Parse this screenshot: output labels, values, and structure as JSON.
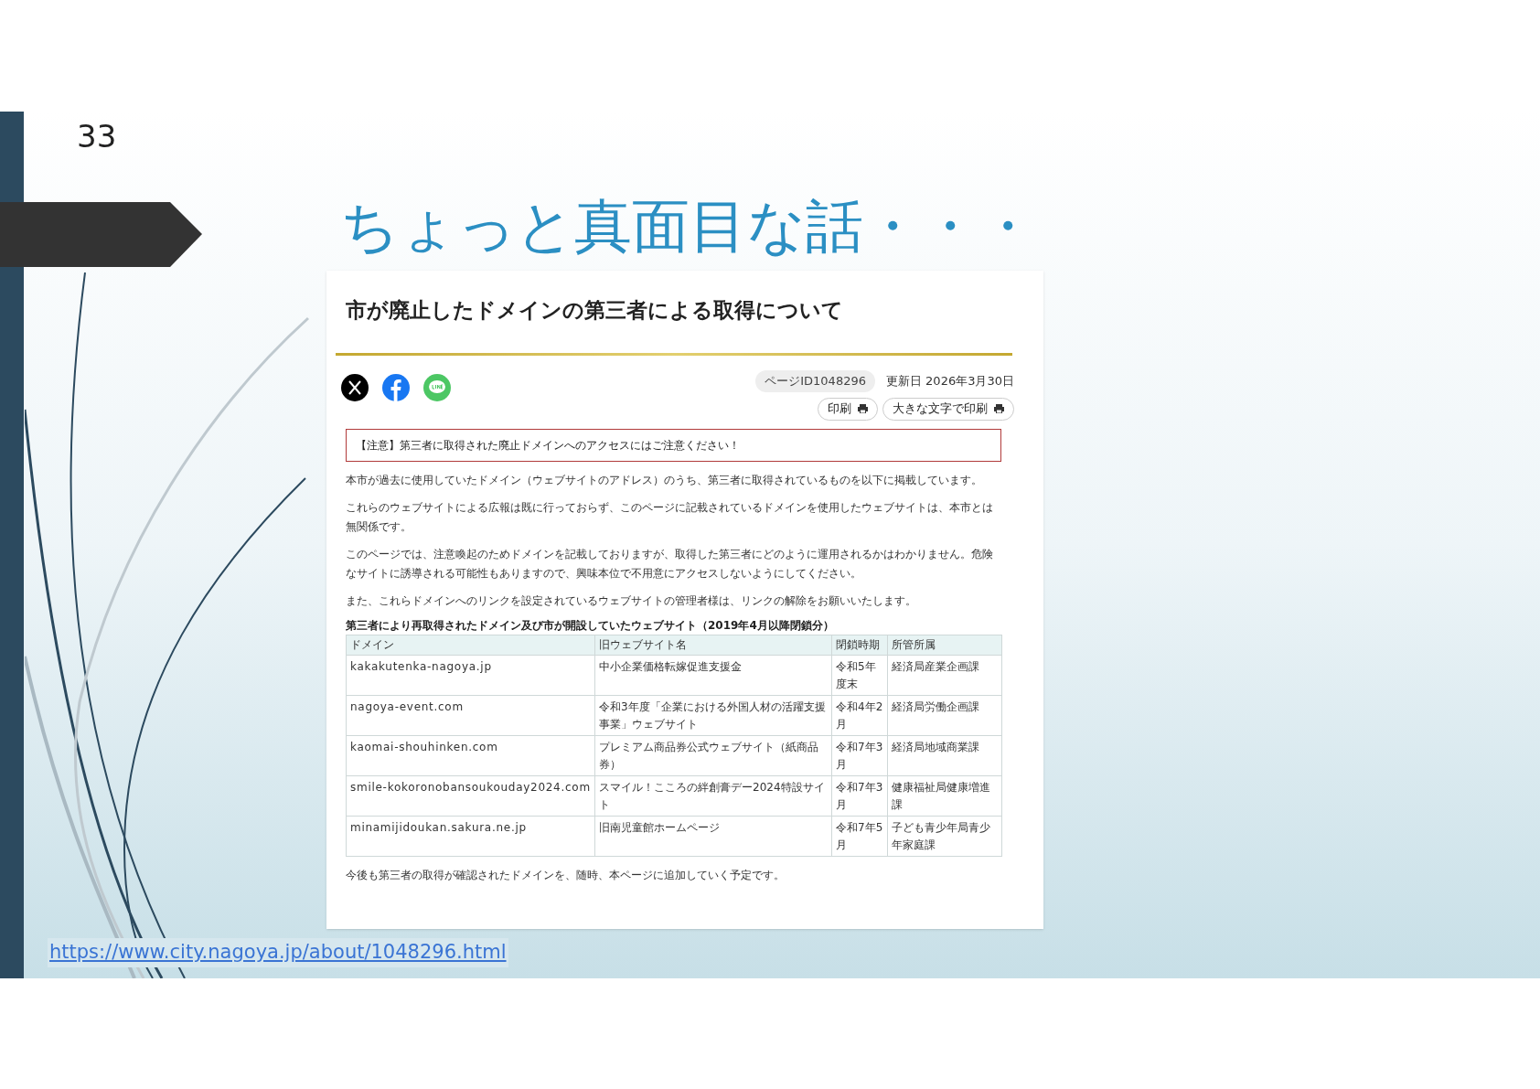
{
  "slide": {
    "page_number": "33",
    "title": "ちょっと真面目な話・・・",
    "source_link": "https://www.city.nagoya.jp/about/1048296.html"
  },
  "webpage": {
    "heading": "市が廃止したドメインの第三者による取得について",
    "page_id": "ページID1048296",
    "updated": "更新日 2026年3月30日",
    "print_buttons": [
      "印刷",
      "大きな文字で印刷"
    ],
    "notice": "【注意】第三者に取得された廃止ドメインへのアクセスにはご注意ください！",
    "paragraphs": [
      "本市が過去に使用していたドメイン（ウェブサイトのアドレス）のうち、第三者に取得されているものを以下に掲載しています。",
      "これらのウェブサイトによる広報は既に行っておらず、このページに記載されているドメインを使用したウェブサイトは、本市とは無関係です。",
      "このページでは、注意喚起のためドメインを記載しておりますが、取得した第三者にどのように運用されるかはわかりません。危険なサイトに誘導される可能性もありますので、興味本位で不用意にアクセスしないようにしてください。",
      "また、これらドメインへのリンクを設定されているウェブサイトの管理者様は、リンクの解除をお願いいたします。"
    ],
    "table": {
      "caption": "第三者により再取得されたドメイン及び市が開設していたウェブサイト（2019年4月以降閉鎖分）",
      "columns": [
        "ドメイン",
        "旧ウェブサイト名",
        "閉鎖時期",
        "所管所属"
      ],
      "rows": [
        [
          "kakakutenka-nagoya.jp",
          "中小企業価格転嫁促進支援金",
          "令和5年度末",
          "経済局産業企画課"
        ],
        [
          "nagoya-event.com",
          "令和3年度「企業における外国人材の活躍支援事業」ウェブサイト",
          "令和4年2月",
          "経済局労働企画課"
        ],
        [
          "kaomai-shouhinken.com",
          "プレミアム商品券公式ウェブサイト（紙商品券）",
          "令和7年3月",
          "経済局地域商業課"
        ],
        [
          "smile-kokoronobansoukouday2024.com",
          "スマイル！こころの絆創膏デー2024特設サイト",
          "令和7年3月",
          "健康福祉局健康増進課"
        ],
        [
          "minamijidoukan.sakura.ne.jp",
          "旧南児童館ホームページ",
          "令和7年5月",
          "子ども青少年局青少年家庭課"
        ]
      ]
    },
    "footer_note": "今後も第三者の取得が確認されたドメインを、随時、本ページに追加していく予定です。"
  }
}
